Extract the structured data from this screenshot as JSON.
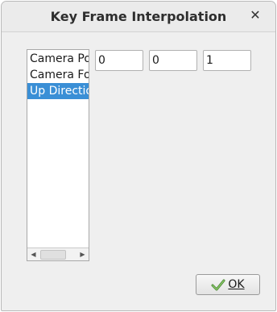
{
  "window": {
    "title": "Key Frame Interpolation",
    "close_glyph": "✕",
    "close_icon": "close-icon"
  },
  "property_list": {
    "items": [
      {
        "label": "Camera Position",
        "selected": false
      },
      {
        "label": "Camera Focal Point",
        "selected": false
      },
      {
        "label": "Up Direction",
        "selected": true
      }
    ],
    "scroll_left_glyph": "◀",
    "scroll_right_glyph": "▶"
  },
  "vector": {
    "x": "0",
    "y": "0",
    "z": "1"
  },
  "ok_button": {
    "label": "OK",
    "icon": "checkmark-arrow-icon"
  },
  "colors": {
    "selection": "#3a8fd6",
    "ok_icon_green": "#4f8a3a"
  }
}
